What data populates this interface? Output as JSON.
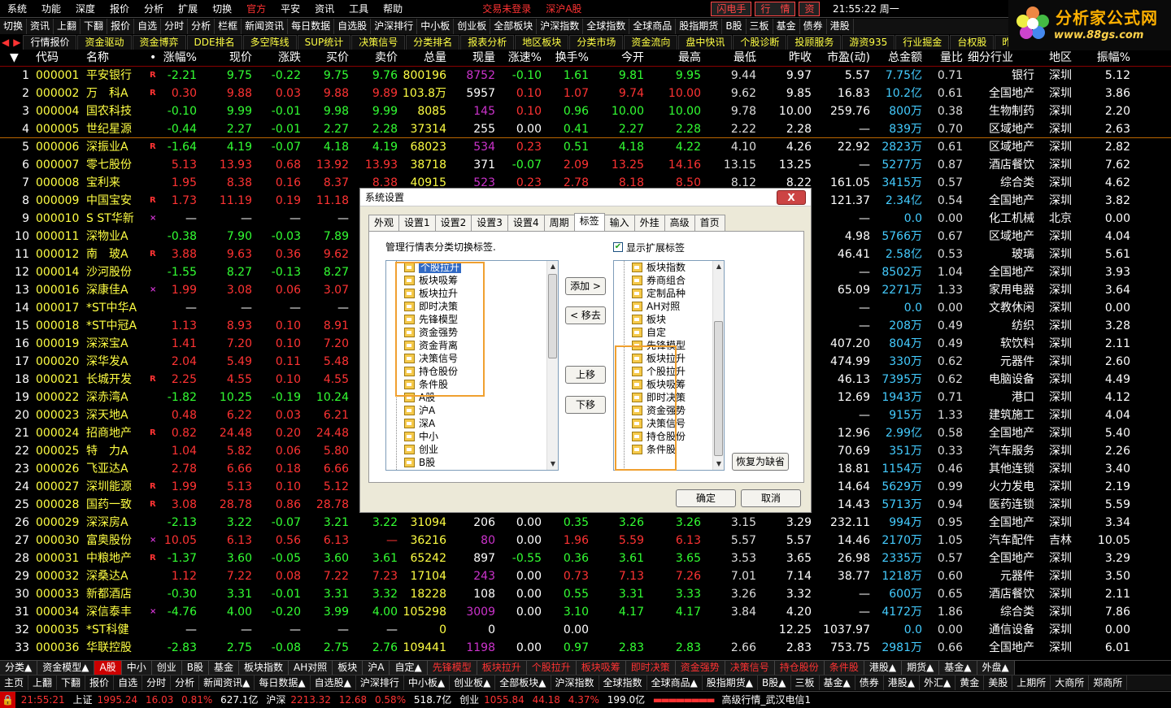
{
  "menubar": {
    "items": [
      "系统",
      "功能",
      "深度",
      "报价",
      "分析",
      "扩展",
      "切换"
    ],
    "official": "官方",
    "pingan": "平安",
    "items2": [
      "资讯",
      "工具",
      "帮助"
    ],
    "login": "交易未登录",
    "market": "深沪A股",
    "clock": "21:55:22 周一",
    "btn_flash": "闪电手",
    "btn_quote": "行　情",
    "btn_zi": "资"
  },
  "logo": {
    "title": "分析家公式网",
    "url": "www.88gs.com"
  },
  "toolbar1": [
    "切换",
    "资讯",
    "上翻",
    "下翻",
    "报价",
    "自选",
    "分时",
    "分析",
    "栏框",
    "新闻资讯",
    "每日数据",
    "自选股",
    "沪深排行",
    "中小板",
    "创业板",
    "全部板块",
    "沪深指数",
    "全球指数",
    "全球商品",
    "股指期货",
    "B股",
    "三板",
    "基金",
    "债券",
    "港股"
  ],
  "toolbar2": [
    "行情报价",
    "资金驱动",
    "资金博弈",
    "DDE排名",
    "多空阵线",
    "SUP统计",
    "决策信号",
    "分类排名",
    "报表分析",
    "地区板块",
    "分类市场",
    "资金流向",
    "盘中快讯",
    "个股诊断",
    "投顾服务",
    "游资935",
    "行业掘金",
    "台权股",
    "昨日涨停"
  ],
  "header": [
    "代码",
    "名称",
    "•",
    "涨幅%",
    "现价",
    "涨跌",
    "买价",
    "卖价",
    "总量",
    "现量",
    "涨速%",
    "换手%",
    "今开",
    "最高",
    "最低",
    "昨收",
    "市盈(动)",
    "总金额",
    "量比",
    "细分行业",
    "地区",
    "振幅%"
  ],
  "rows": [
    [
      "1",
      "000001",
      "平安银行",
      "R",
      "-2.21",
      "9.75",
      "-0.22",
      "9.75",
      "9.76",
      "800196",
      "8752",
      "-0.10",
      "1.61",
      "9.81",
      "9.95",
      "9.44",
      "9.97",
      "5.57",
      "7.75亿",
      "0.71",
      "银行",
      "深圳",
      "5.12"
    ],
    [
      "2",
      "000002",
      "万　科A",
      "R",
      "0.30",
      "9.88",
      "0.03",
      "9.88",
      "9.89",
      "103.8万",
      "5957",
      "0.10",
      "1.07",
      "9.74",
      "10.00",
      "9.62",
      "9.85",
      "16.83",
      "10.2亿",
      "0.61",
      "全国地产",
      "深圳",
      "3.86"
    ],
    [
      "3",
      "000004",
      "国农科技",
      "",
      "-0.10",
      "9.99",
      "-0.01",
      "9.98",
      "9.99",
      "8085",
      "145",
      "0.10",
      "0.96",
      "10.00",
      "10.00",
      "9.78",
      "10.00",
      "259.76",
      "800万",
      "0.38",
      "生物制药",
      "深圳",
      "2.20"
    ],
    [
      "4",
      "000005",
      "世纪星源",
      "",
      "-0.44",
      "2.27",
      "-0.01",
      "2.27",
      "2.28",
      "37314",
      "255",
      "0.00",
      "0.41",
      "2.27",
      "2.28",
      "2.22",
      "2.28",
      "—",
      "839万",
      "0.70",
      "区域地产",
      "深圳",
      "2.63"
    ],
    [
      "5",
      "000006",
      "深振业A",
      "R",
      "-1.64",
      "4.19",
      "-0.07",
      "4.18",
      "4.19",
      "68023",
      "534",
      "0.23",
      "0.51",
      "4.18",
      "4.22",
      "4.10",
      "4.26",
      "22.92",
      "2823万",
      "0.61",
      "区域地产",
      "深圳",
      "2.82"
    ],
    [
      "6",
      "000007",
      "零七股份",
      "",
      "5.13",
      "13.93",
      "0.68",
      "13.92",
      "13.93",
      "38718",
      "371",
      "-0.07",
      "2.09",
      "13.25",
      "14.16",
      "13.15",
      "13.25",
      "—",
      "5277万",
      "0.87",
      "酒店餐饮",
      "深圳",
      "7.62"
    ],
    [
      "7",
      "000008",
      "宝利来",
      "",
      "1.95",
      "8.38",
      "0.16",
      "8.37",
      "8.38",
      "40915",
      "523",
      "0.23",
      "2.78",
      "8.18",
      "8.50",
      "8.12",
      "8.22",
      "161.05",
      "3415万",
      "0.57",
      "综合类",
      "深圳",
      "4.62"
    ],
    [
      "8",
      "000009",
      "中国宝安",
      "R",
      "1.73",
      "11.19",
      "0.19",
      "11.18",
      "11.19",
      "",
      "",
      "",
      "",
      "",
      "",
      "",
      "",
      "121.37",
      "2.34亿",
      "0.54",
      "全国地产",
      "深圳",
      "3.82"
    ],
    [
      "9",
      "000010",
      "S ST华新",
      "×",
      "—",
      "—",
      "—",
      "—",
      "",
      "",
      "",
      "",
      "",
      "",
      "",
      "",
      "",
      "—",
      "0.0",
      "0.00",
      "化工机械",
      "北京",
      "0.00"
    ],
    [
      "10",
      "000011",
      "深物业A",
      "",
      "-0.38",
      "7.90",
      "-0.03",
      "7.89",
      "",
      "",
      "",
      "",
      "",
      "",
      "",
      "",
      "",
      "4.98",
      "5766万",
      "0.67",
      "区域地产",
      "深圳",
      "4.04"
    ],
    [
      "11",
      "000012",
      "南　玻A",
      "R",
      "3.88",
      "9.63",
      "0.36",
      "9.62",
      "",
      "",
      "",
      "",
      "",
      "",
      "",
      "",
      "",
      "46.41",
      "2.58亿",
      "0.53",
      "玻璃",
      "深圳",
      "5.61"
    ],
    [
      "12",
      "000014",
      "沙河股份",
      "",
      "-1.55",
      "8.27",
      "-0.13",
      "8.27",
      "",
      "",
      "",
      "",
      "",
      "",
      "",
      "",
      "",
      "—",
      "8502万",
      "1.04",
      "全国地产",
      "深圳",
      "3.93"
    ],
    [
      "13",
      "000016",
      "深康佳A",
      "×",
      "1.99",
      "3.08",
      "0.06",
      "3.07",
      "",
      "",
      "",
      "",
      "",
      "",
      "",
      "",
      "",
      "65.09",
      "2271万",
      "1.33",
      "家用电器",
      "深圳",
      "3.64"
    ],
    [
      "14",
      "000017",
      "*ST中华A",
      "",
      "—",
      "—",
      "—",
      "—",
      "",
      "",
      "",
      "",
      "",
      "",
      "",
      "",
      "",
      "—",
      "0.0",
      "0.00",
      "文教休闲",
      "深圳",
      "0.00"
    ],
    [
      "15",
      "000018",
      "*ST中冠A",
      "",
      "1.13",
      "8.93",
      "0.10",
      "8.91",
      "",
      "",
      "",
      "",
      "",
      "",
      "",
      "",
      "",
      "—",
      "208万",
      "0.49",
      "纺织",
      "深圳",
      "3.28"
    ],
    [
      "16",
      "000019",
      "深深宝A",
      "",
      "1.41",
      "7.20",
      "0.10",
      "7.20",
      "",
      "",
      "",
      "",
      "",
      "",
      "",
      "",
      "",
      "407.20",
      "804万",
      "0.49",
      "软饮料",
      "深圳",
      "2.11"
    ],
    [
      "17",
      "000020",
      "深华发A",
      "",
      "2.04",
      "5.49",
      "0.11",
      "5.48",
      "",
      "",
      "",
      "",
      "",
      "",
      "",
      "",
      "",
      "474.99",
      "330万",
      "0.62",
      "元器件",
      "深圳",
      "2.60"
    ],
    [
      "18",
      "000021",
      "长城开发",
      "R",
      "2.25",
      "4.55",
      "0.10",
      "4.55",
      "",
      "",
      "",
      "",
      "",
      "",
      "",
      "",
      "",
      "46.13",
      "7395万",
      "0.62",
      "电脑设备",
      "深圳",
      "4.49"
    ],
    [
      "19",
      "000022",
      "深赤湾A",
      "",
      "-1.82",
      "10.25",
      "-0.19",
      "10.24",
      "",
      "",
      "",
      "",
      "",
      "",
      "",
      "",
      "",
      "12.69",
      "1943万",
      "0.71",
      "港口",
      "深圳",
      "4.12"
    ],
    [
      "20",
      "000023",
      "深天地A",
      "",
      "0.48",
      "6.22",
      "0.03",
      "6.21",
      "",
      "",
      "",
      "",
      "",
      "",
      "",
      "",
      "",
      "—",
      "915万",
      "1.33",
      "建筑施工",
      "深圳",
      "4.04"
    ],
    [
      "21",
      "000024",
      "招商地产",
      "R",
      "0.82",
      "24.48",
      "0.20",
      "24.48",
      "",
      "",
      "",
      "",
      "",
      "",
      "",
      "",
      "",
      "12.96",
      "2.99亿",
      "0.58",
      "全国地产",
      "深圳",
      "5.40"
    ],
    [
      "22",
      "000025",
      "特　力A",
      "",
      "1.04",
      "5.82",
      "0.06",
      "5.80",
      "",
      "",
      "",
      "",
      "",
      "",
      "",
      "",
      "",
      "70.69",
      "351万",
      "0.33",
      "汽车服务",
      "深圳",
      "2.26"
    ],
    [
      "23",
      "000026",
      "飞亚达A",
      "",
      "2.78",
      "6.66",
      "0.18",
      "6.66",
      "",
      "",
      "",
      "",
      "",
      "",
      "",
      "",
      "",
      "18.81",
      "1154万",
      "0.46",
      "其他连锁",
      "深圳",
      "3.40"
    ],
    [
      "24",
      "000027",
      "深圳能源",
      "R",
      "1.99",
      "5.13",
      "0.10",
      "5.12",
      "",
      "",
      "",
      "",
      "",
      "",
      "",
      "",
      "",
      "14.64",
      "5629万",
      "0.99",
      "火力发电",
      "深圳",
      "2.19"
    ],
    [
      "25",
      "000028",
      "国药一致",
      "R",
      "3.08",
      "28.78",
      "0.86",
      "28.78",
      "",
      "",
      "",
      "",
      "",
      "",
      "",
      "",
      "",
      "14.43",
      "5713万",
      "0.94",
      "医药连锁",
      "深圳",
      "5.59"
    ],
    [
      "26",
      "000029",
      "深深房A",
      "",
      "-2.13",
      "3.22",
      "-0.07",
      "3.21",
      "3.22",
      "31094",
      "206",
      "0.00",
      "0.35",
      "3.26",
      "3.26",
      "3.15",
      "3.29",
      "232.11",
      "994万",
      "0.95",
      "全国地产",
      "深圳",
      "3.34"
    ],
    [
      "27",
      "000030",
      "富奥股份",
      "×",
      "10.05",
      "6.13",
      "0.56",
      "6.13",
      "—",
      "36216",
      "80",
      "0.00",
      "1.96",
      "5.59",
      "6.13",
      "5.57",
      "5.57",
      "14.46",
      "2170万",
      "1.05",
      "汽车配件",
      "吉林",
      "10.05"
    ],
    [
      "28",
      "000031",
      "中粮地产",
      "R",
      "-1.37",
      "3.60",
      "-0.05",
      "3.60",
      "3.61",
      "65242",
      "897",
      "-0.55",
      "0.36",
      "3.61",
      "3.65",
      "3.53",
      "3.65",
      "26.98",
      "2335万",
      "0.57",
      "全国地产",
      "深圳",
      "3.29"
    ],
    [
      "29",
      "000032",
      "深桑达A",
      "",
      "1.12",
      "7.22",
      "0.08",
      "7.22",
      "7.23",
      "17104",
      "243",
      "0.00",
      "0.73",
      "7.13",
      "7.26",
      "7.01",
      "7.14",
      "38.77",
      "1218万",
      "0.60",
      "元器件",
      "深圳",
      "3.50"
    ],
    [
      "30",
      "000033",
      "新都酒店",
      "",
      "-0.30",
      "3.31",
      "-0.01",
      "3.31",
      "3.32",
      "18228",
      "108",
      "0.00",
      "0.55",
      "3.31",
      "3.33",
      "3.26",
      "3.32",
      "—",
      "600万",
      "0.65",
      "酒店餐饮",
      "深圳",
      "2.11"
    ],
    [
      "31",
      "000034",
      "深信泰丰",
      "×",
      "-4.76",
      "4.00",
      "-0.20",
      "3.99",
      "4.00",
      "105298",
      "3009",
      "0.00",
      "3.10",
      "4.17",
      "4.17",
      "3.84",
      "4.20",
      "—",
      "4172万",
      "1.86",
      "综合类",
      "深圳",
      "7.86"
    ],
    [
      "32",
      "000035",
      "*ST科健",
      "",
      "—",
      "—",
      "—",
      "—",
      "—",
      "0",
      "0",
      "",
      "0.00",
      "",
      "",
      "",
      "12.25",
      "1037.97",
      "0.0",
      "0.00",
      "通信设备",
      "深圳",
      "0.00"
    ],
    [
      "33",
      "000036",
      "华联控股",
      "",
      "-2.83",
      "2.75",
      "-0.08",
      "2.75",
      "2.76",
      "109441",
      "1198",
      "0.00",
      "0.97",
      "2.83",
      "2.83",
      "2.66",
      "2.83",
      "753.75",
      "2981万",
      "0.66",
      "全国地产",
      "深圳",
      "6.01"
    ]
  ],
  "tabs": [
    "分类▲",
    "资金模型▲",
    "A股",
    "中小",
    "创业",
    "B股",
    "基金",
    "板块指数",
    "AH对照",
    "板块",
    "沪A",
    "自定▲",
    "先锋模型",
    "板块拉升",
    "个股拉升",
    "板块吸筹",
    "即时决策",
    "资金强势",
    "决策信号",
    "持仓股份",
    "条件股",
    "港股▲",
    "期货▲",
    "基金▲",
    "外盘▲"
  ],
  "navbar": [
    "主页",
    "上翻",
    "下翻",
    "报价",
    "自选",
    "分时",
    "分析",
    "新闻资讯▲",
    "每日数据▲",
    "自选股▲",
    "沪深排行",
    "中小板▲",
    "创业板▲",
    "全部板块▲",
    "沪深指数",
    "全球指数",
    "全球商品▲",
    "股指期货▲",
    "B股▲",
    "三板",
    "基金▲",
    "债券",
    "港股▲",
    "外汇▲",
    "黄金",
    "美股",
    "上期所",
    "大商所",
    "郑商所"
  ],
  "statusbar": {
    "time": "21:55:21",
    "sh_label": "上证",
    "sh_val": "1995.24",
    "sh_chg": "16.03",
    "sh_pct": "0.81%",
    "sh_amt": "627.1亿",
    "sz_label": "沪深",
    "sz_val": "2213.32",
    "sz_chg": "12.68",
    "sz_pct": "0.58%",
    "sz_amt": "518.7亿",
    "cy_label": "创业",
    "cy_val": "1055.84",
    "cy_chg": "44.18",
    "cy_pct": "4.37%",
    "cy_amt": "199.0亿",
    "server": "高级行情_武汉电信1"
  },
  "dialog": {
    "title": "系统设置",
    "close": "X",
    "tabs": [
      "外观",
      "设置1",
      "设置2",
      "设置3",
      "设置4",
      "周期",
      "标签",
      "输入",
      "外挂",
      "高级",
      "首页"
    ],
    "active_tab": "标签",
    "desc": "管理行情表分类切换标签.",
    "show_ext_label": "显示扩展标签",
    "left_items": [
      "个股拉升",
      "板块吸筹",
      "板块拉升",
      "即时决策",
      "先锋模型",
      "资金强势",
      "资金背离",
      "决策信号",
      "持仓股份",
      "条件股",
      "A股",
      "沪A",
      "深A",
      "中小",
      "创业",
      "B股"
    ],
    "right_items": [
      "板块指数",
      "券商组合",
      "定制品种",
      "AH对照",
      "板块",
      "自定",
      "先锋模型",
      "板块拉升",
      "个股拉升",
      "板块吸筹",
      "即时决策",
      "资金强势",
      "决策信号",
      "持仓股份",
      "条件股"
    ],
    "btn_add": "添加 >",
    "btn_remove": "< 移去",
    "btn_up": "上移",
    "btn_down": "下移",
    "btn_restore": "恢复为缺省",
    "btn_ok": "确定",
    "btn_cancel": "取消"
  },
  "colors": {
    "up": "#ff3333",
    "down": "#33ff33",
    "label": "#ffff44",
    "accent": "#316ac5"
  }
}
